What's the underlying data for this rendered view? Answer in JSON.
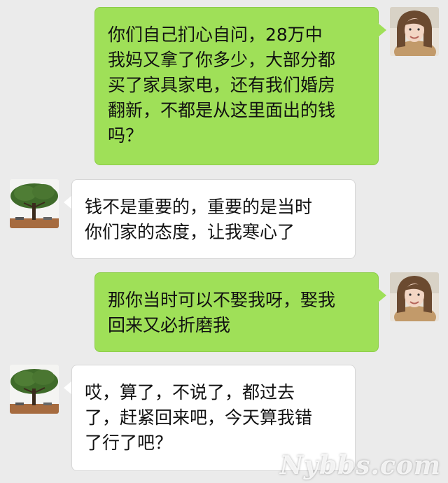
{
  "conversation": {
    "messages": [
      {
        "sender": "me",
        "text": "你们自己扪心自问，28万中\n我妈又拿了你多少，大部分都\n买了家具家电，还有我们婚房\n翻新，不都是从这里面出的钱\n吗？"
      },
      {
        "sender": "other",
        "text": "钱不是重要的，重要的是当时\n你们家的态度，让我寒心了"
      },
      {
        "sender": "me",
        "text": "那你当时可以不娶我呀，娶我\n回来又必折磨我"
      },
      {
        "sender": "other",
        "text": "哎，算了，不说了，都过去\n了，赶紧回来吧，今天算我错\n了行了吧？"
      }
    ]
  },
  "avatars": {
    "me": "woman-photo-avatar",
    "other": "tree-photo-avatar"
  },
  "colors": {
    "background": "#ebebeb",
    "my_bubble": "#9fe058",
    "other_bubble": "#ffffff"
  },
  "watermark": "Nybbs.com"
}
